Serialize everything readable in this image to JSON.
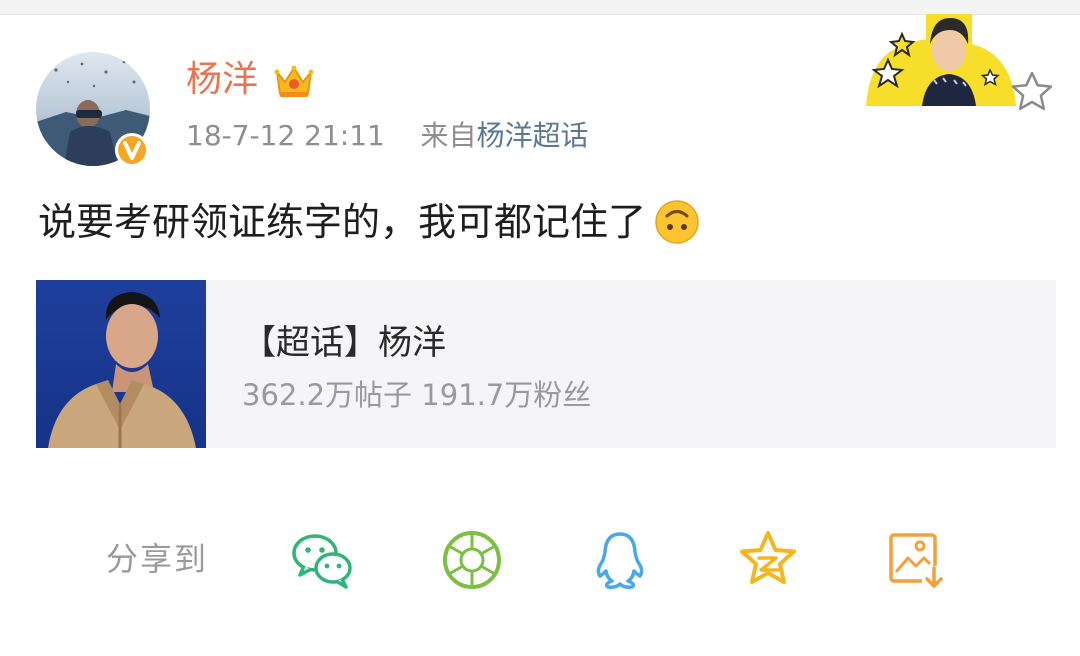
{
  "post": {
    "author_name": "杨洋",
    "timestamp": "18-7-12 21:11",
    "source_prefix": "来自",
    "source_name": "杨洋超话",
    "text": "说要考研领证练字的，我可都记住了",
    "emoji": "upside-down-face"
  },
  "topic_card": {
    "title": "【超话】杨洋",
    "stats": "362.2万帖子 191.7万粉丝"
  },
  "share": {
    "label": "分享到",
    "targets": [
      "wechat-icon",
      "moments-icon",
      "qq-icon",
      "qzone-icon",
      "save-image-icon"
    ]
  },
  "colors": {
    "author": "#eb7350",
    "source_link": "#5d7895",
    "muted": "#8e8e8e",
    "wechat": "#2fb47a",
    "moments": "#7cbf43",
    "qq": "#49a8e6",
    "qzone": "#f5b51f",
    "save": "#f2a13a",
    "verified": "#f5a623"
  }
}
